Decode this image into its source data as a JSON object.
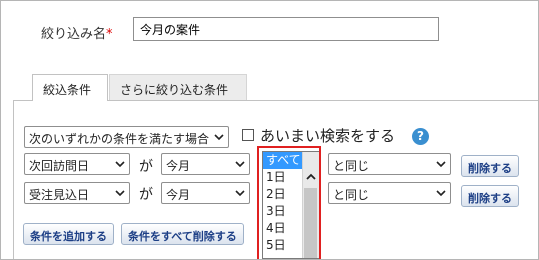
{
  "filter_name": {
    "label": "絞り込み名",
    "required_mark": "*",
    "value": "今月の案件"
  },
  "tabs": [
    {
      "label": "絞込条件",
      "active": true
    },
    {
      "label": "さらに絞り込む条件",
      "active": false
    }
  ],
  "match_mode": {
    "selected": "次のいずれかの条件を満たす場合"
  },
  "fuzzy_search": {
    "label": "あいまい検索をする",
    "checked": false
  },
  "help_icon": {
    "glyph": "?",
    "color": "#3a8fd0"
  },
  "conditions": [
    {
      "field": "次回訪問日",
      "particle": "が",
      "period": "今月",
      "operator": "と同じ",
      "delete_label": "削除する"
    },
    {
      "field": "受注見込日",
      "particle": "が",
      "period": "今月",
      "operator": "と同じ",
      "delete_label": "削除する"
    }
  ],
  "offset_listbox": {
    "options": [
      "すべて",
      "1日",
      "2日",
      "3日",
      "4日",
      "5日"
    ],
    "selected": "すべて"
  },
  "buttons": {
    "add_condition": "条件を追加する",
    "delete_all_conditions": "条件をすべて削除する"
  },
  "colors": {
    "required": "#dd0000",
    "selection": "#3399ff",
    "highlight": "#e02020",
    "button_text": "#1d3f86"
  }
}
